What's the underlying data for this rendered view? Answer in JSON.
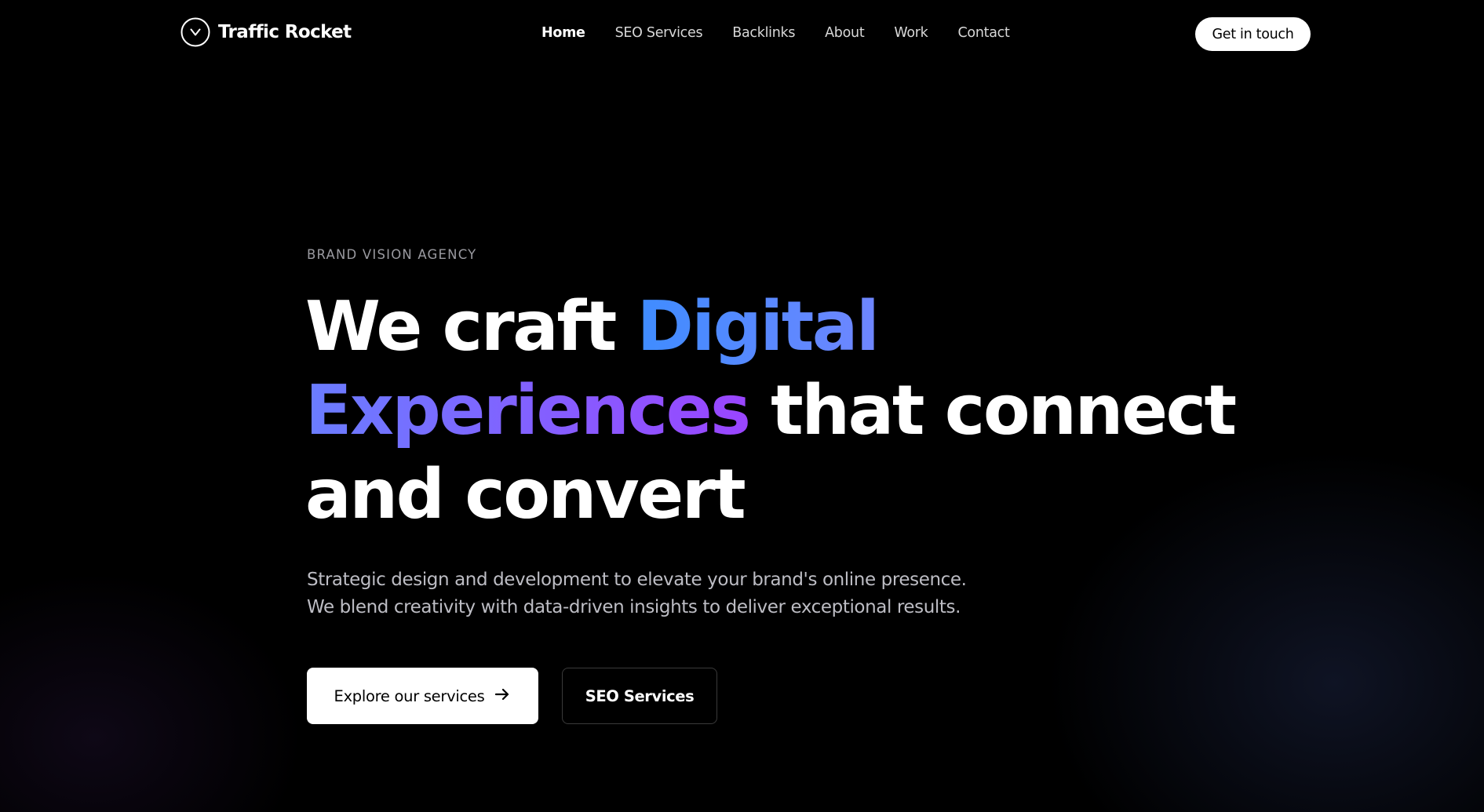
{
  "header": {
    "logo_text": "Traffic Rocket",
    "nav": [
      "Home",
      "SEO Services",
      "Backlinks",
      "About",
      "Work",
      "Contact"
    ],
    "active_nav": "Home",
    "cta_label": "Get in touch"
  },
  "hero": {
    "eyebrow": "BRAND VISION AGENCY",
    "headline": {
      "part1": "We craft ",
      "part2": "Digital",
      "part3": "Experiences",
      "part4": " that connect",
      "part5": "and convert"
    },
    "subtext_line1": "Strategic design and development to elevate your brand's online presence.",
    "subtext_line2": "We blend creativity with data-driven insights to deliver exceptional results.",
    "primary_button": "Explore our services",
    "secondary_button": "SEO Services"
  },
  "colors": {
    "background": "#000000",
    "gradient_blue": "#3f8cff",
    "gradient_purple": "#9a45ff",
    "button_light": "#ffffff"
  },
  "icons": {
    "logo": "chevron-down-circle-icon",
    "primary_button": "arrow-right-icon"
  }
}
